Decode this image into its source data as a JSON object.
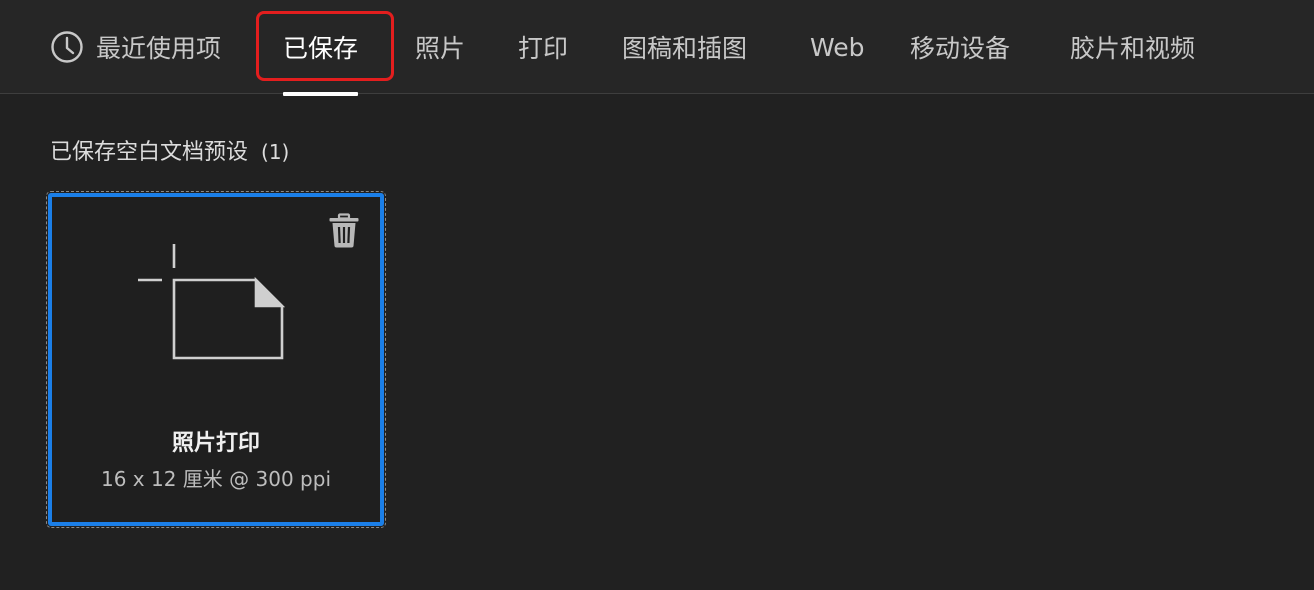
{
  "tabs": [
    {
      "label": "最近使用项",
      "icon": "clock-icon"
    },
    {
      "label": "已保存",
      "active": true
    },
    {
      "label": "照片"
    },
    {
      "label": "打印"
    },
    {
      "label": "图稿和插图"
    },
    {
      "label": "Web"
    },
    {
      "label": "移动设备"
    },
    {
      "label": "胶片和视频"
    }
  ],
  "section": {
    "title": "已保存空白文档预设",
    "count": "(1)"
  },
  "preset_card": {
    "name": "照片打印",
    "size": "16 x 12 厘米 @ 300 ppi",
    "delete_icon": "trash-icon",
    "thumbnail_icon": "blank-document-icon"
  },
  "colors": {
    "background": "#212121",
    "tabbar": "#262626",
    "selection_border": "#1b7fe8",
    "highlight": "#e31e1e"
  }
}
